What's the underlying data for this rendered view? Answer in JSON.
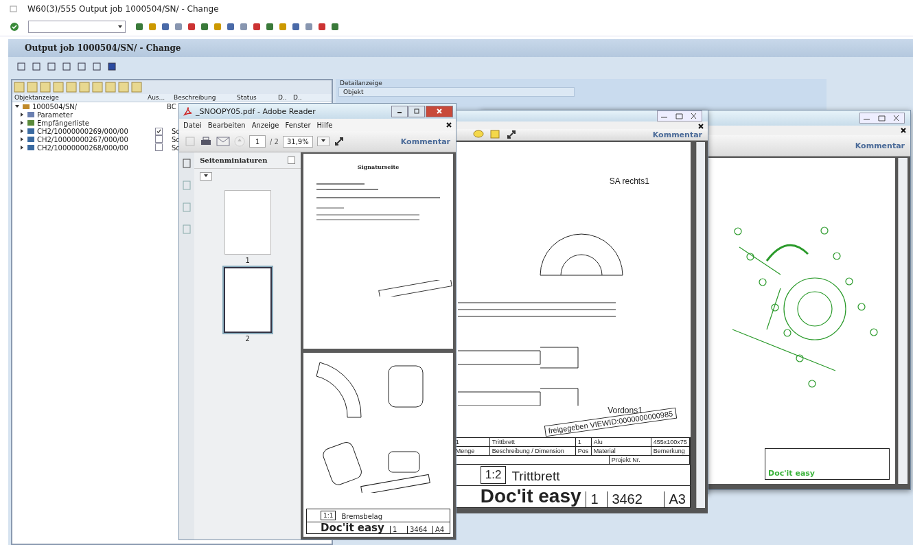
{
  "window": {
    "title": "W60(3)/555 Output job 1000504/SN/ - Change"
  },
  "screen_title": "Output job 1000504/SN/ - Change",
  "tree": {
    "columns": [
      "Objektanzeige",
      "Aus...",
      "Beschreibung",
      "Status",
      "D..",
      "D.."
    ],
    "rows": [
      {
        "label": "1000504/SN/",
        "kind": "folder",
        "expanded": true,
        "description": "BC",
        "children": [
          {
            "label": "Parameter",
            "kind": "params",
            "expanded": false
          },
          {
            "label": "Empfängerliste",
            "kind": "recipients",
            "expanded": false
          },
          {
            "label": "CH2/10000000269/000/00",
            "kind": "document",
            "expanded": false,
            "checked": true,
            "description": "Sc"
          },
          {
            "label": "CH2/10000000267/000/00",
            "kind": "document",
            "expanded": false,
            "checked": false,
            "description": "Sc"
          },
          {
            "label": "CH2/10000000268/000/00",
            "kind": "document",
            "expanded": false,
            "checked": false,
            "description": "Sc"
          }
        ]
      }
    ]
  },
  "detail": {
    "title": "Detailanzeige",
    "tab": "Objekt"
  },
  "reader_back": {
    "comment": "Kommentar",
    "brand": "Doc'it easy"
  },
  "reader_middle": {
    "comment": "Kommentar",
    "labels": [
      "SA rechts1",
      "Vordons1"
    ],
    "stamp": "freigegeben VIEWID:0000000000985",
    "title_block": {
      "rows": [
        [
          "1",
          "Trittbrett",
          "1",
          "Alu",
          "455x100x75"
        ],
        [
          "Menge",
          "Beschreibung / Dimension",
          "Pos",
          "Material",
          "Bemerkung"
        ]
      ],
      "project": "Projekt Nr.",
      "scale": "1:2",
      "name": "Trittbrett",
      "brand": "Doc'it easy",
      "version": "1",
      "number": "3462",
      "format": "A3"
    }
  },
  "reader_front": {
    "title": "_SNOOPY05.pdf - Adobe Reader",
    "menu": [
      "Datei",
      "Bearbeiten",
      "Anzeige",
      "Fenster",
      "Hilfe"
    ],
    "page": "1",
    "pages": "/ 2",
    "zoom": "31,9%",
    "comment": "Kommentar",
    "sidebar_title": "Seitenminiaturen",
    "thumbnails": [
      {
        "label": "1",
        "selected": false
      },
      {
        "label": "2",
        "selected": true
      }
    ],
    "page1_title": "Signaturseite",
    "title_block": {
      "scale": "1:1",
      "name": "Bremsbelag",
      "brand": "Doc'it easy",
      "version": "1",
      "number": "3464",
      "format": "A4"
    }
  }
}
